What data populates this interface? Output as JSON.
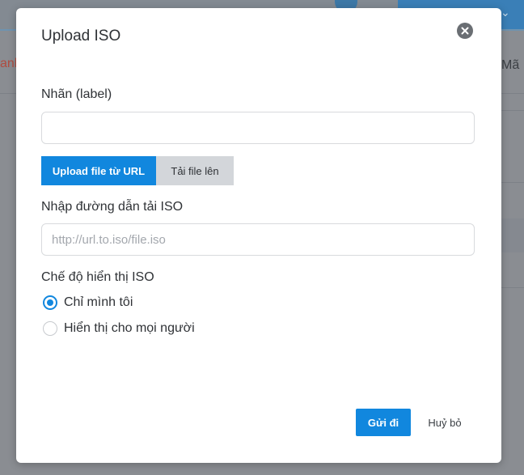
{
  "background": {
    "nav_left_fragment": "anh",
    "nav_right_fragment": "Mã"
  },
  "modal": {
    "title": "Upload ISO",
    "close_icon": "close-circle-icon",
    "label_field": {
      "label": "Nhãn (label)",
      "value": "",
      "placeholder": ""
    },
    "tabs": [
      {
        "label": "Upload file từ URL",
        "active": true
      },
      {
        "label": "Tải file lên",
        "active": false
      }
    ],
    "url_field": {
      "label": "Nhập đường dẫn tải ISO",
      "value": "",
      "placeholder": "http://url.to.iso/file.iso"
    },
    "visibility": {
      "label": "Chế độ hiển thị ISO",
      "options": [
        {
          "label": "Chỉ mình tôi",
          "checked": true
        },
        {
          "label": "Hiển thị cho mọi người",
          "checked": false
        }
      ]
    },
    "actions": {
      "submit": "Gửi đi",
      "cancel": "Huỷ bỏ"
    }
  },
  "colors": {
    "primary": "#1187de",
    "tab_inactive": "#d3d6da",
    "text": "#2f3236",
    "overlay": "#8a8d92"
  }
}
